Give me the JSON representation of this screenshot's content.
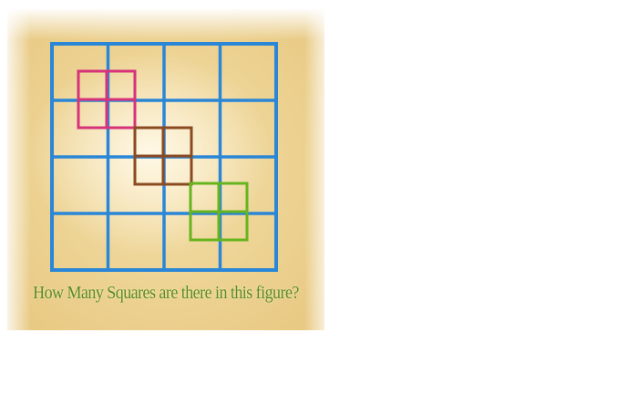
{
  "question": "How Many Squares are there in this figure?",
  "grid": {
    "rows": 4,
    "columns": 4,
    "line_color": "#2a86d6"
  },
  "highlights": [
    {
      "name": "pink",
      "color": "#d6337a",
      "cells": 2
    },
    {
      "name": "brown",
      "color": "#8a4a22",
      "cells": 2
    },
    {
      "name": "green",
      "color": "#66b41e",
      "cells": 2
    }
  ],
  "colors": {
    "background": "#ecd08c",
    "text": "#5a8a1e"
  }
}
